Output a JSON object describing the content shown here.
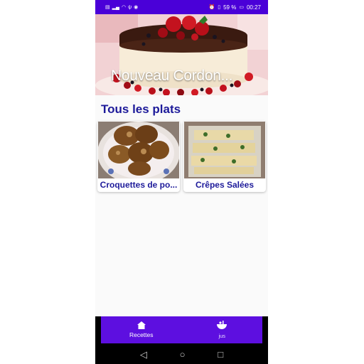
{
  "status_bar": {
    "left_icons": [
      "sim-icon",
      "signal-icon",
      "wifi-icon",
      "usb-icon",
      "app-notification-icon"
    ],
    "battery": "59 %",
    "time": "00:27"
  },
  "hero": {
    "title": "Nouveau Cordon..."
  },
  "section": {
    "title": "Tous les plats"
  },
  "cards": [
    {
      "title": "Croquettes de po..."
    },
    {
      "title": "Crêpes Salées"
    }
  ],
  "bottom_nav": {
    "items": [
      {
        "label": "Recettes",
        "icon": "home-icon"
      },
      {
        "label": "jus",
        "icon": "juice-icon"
      }
    ]
  },
  "system_nav": {
    "back": "◁",
    "home": "○",
    "recents": "□"
  },
  "colors": {
    "status_bar": "#4a00d8",
    "accent": "#5d0fe0",
    "title_text": "#1d1a9a"
  }
}
